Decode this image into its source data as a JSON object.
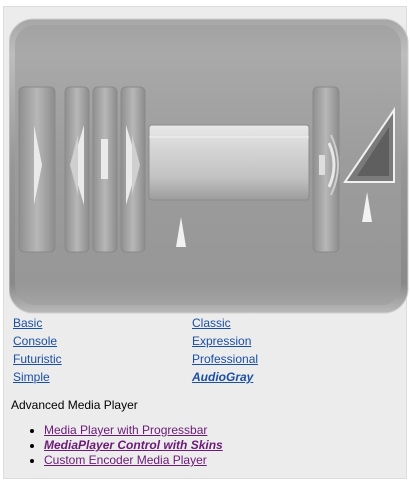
{
  "player": {
    "buttons": [
      {
        "name": "play-button",
        "icon": "play-icon"
      },
      {
        "name": "rewind-button",
        "icon": "rewind-icon"
      },
      {
        "name": "stop-button",
        "icon": "stop-icon"
      },
      {
        "name": "fast-forward-button",
        "icon": "fast-forward-icon"
      }
    ],
    "progress_fraction": 0.2,
    "volume_fraction": 0.45,
    "colors": {
      "body": "#8d8d8d",
      "button": "#a9a9a9",
      "track": "#c8c8c8",
      "marker": "#ffffff"
    }
  },
  "skins": {
    "left": [
      "Basic",
      "Console",
      "Futuristic",
      "Simple"
    ],
    "right": [
      "Classic",
      "Expression",
      "Professional",
      "AudioGray"
    ],
    "active": "AudioGray",
    "link_color": "#1a4fa3"
  },
  "section_title": "Advanced Media Player",
  "related": [
    {
      "label": "Media Player with Progressbar",
      "active": false
    },
    {
      "label": "MediaPlayer Control with Skins",
      "active": true
    },
    {
      "label": "Custom Encoder Media Player",
      "active": false
    }
  ],
  "related_link_color": "#6b1a77"
}
